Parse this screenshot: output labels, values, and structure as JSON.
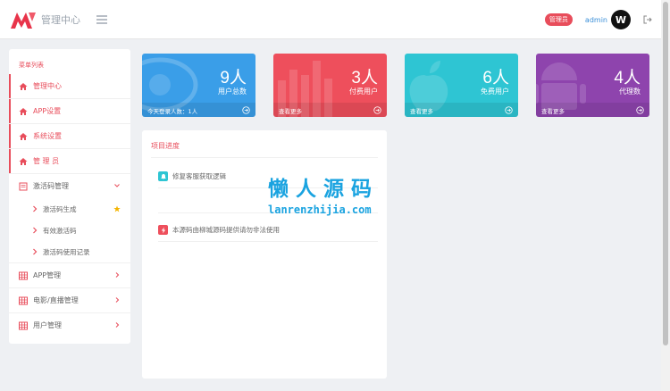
{
  "header": {
    "brand": "管理中心",
    "role_badge": "管理员",
    "admin_name": "admin",
    "avatar_letter": "W"
  },
  "sidebar": {
    "title": "菜单列表",
    "items": [
      {
        "label": "管理中心"
      },
      {
        "label": "APP设置"
      },
      {
        "label": "系统设置"
      },
      {
        "label": "管 理 员"
      },
      {
        "label": "激活码管理"
      },
      {
        "label": "APP管理"
      },
      {
        "label": "电影/直播管理"
      },
      {
        "label": "用户管理"
      }
    ],
    "subitems": [
      {
        "label": "激活码生成"
      },
      {
        "label": "有效激活码"
      },
      {
        "label": "激活码使用记录"
      }
    ]
  },
  "cards": [
    {
      "number": "9人",
      "label": "用户总数",
      "footer": "今天登录人数：1人",
      "color": "#3a9ee8"
    },
    {
      "number": "3人",
      "label": "付费用户",
      "footer": "查看更多",
      "color": "#ee4f5c"
    },
    {
      "number": "6人",
      "label": "免费用户",
      "footer": "查看更多",
      "color": "#2ec5d3"
    },
    {
      "number": "4人",
      "label": "代理数",
      "footer": "查看更多",
      "color": "#8e44ad"
    }
  ],
  "panel": {
    "title": "项目进度",
    "items": [
      {
        "text": "修复客服获取逻辑"
      },
      {
        "text": "本源码由柳城源码提供请勿非法使用"
      }
    ]
  },
  "watermark": {
    "cn": "懒人源码",
    "en": "lanrenzhijia.com"
  },
  "colors": {
    "accent": "#e84d5b",
    "link": "#3a8fd8"
  }
}
